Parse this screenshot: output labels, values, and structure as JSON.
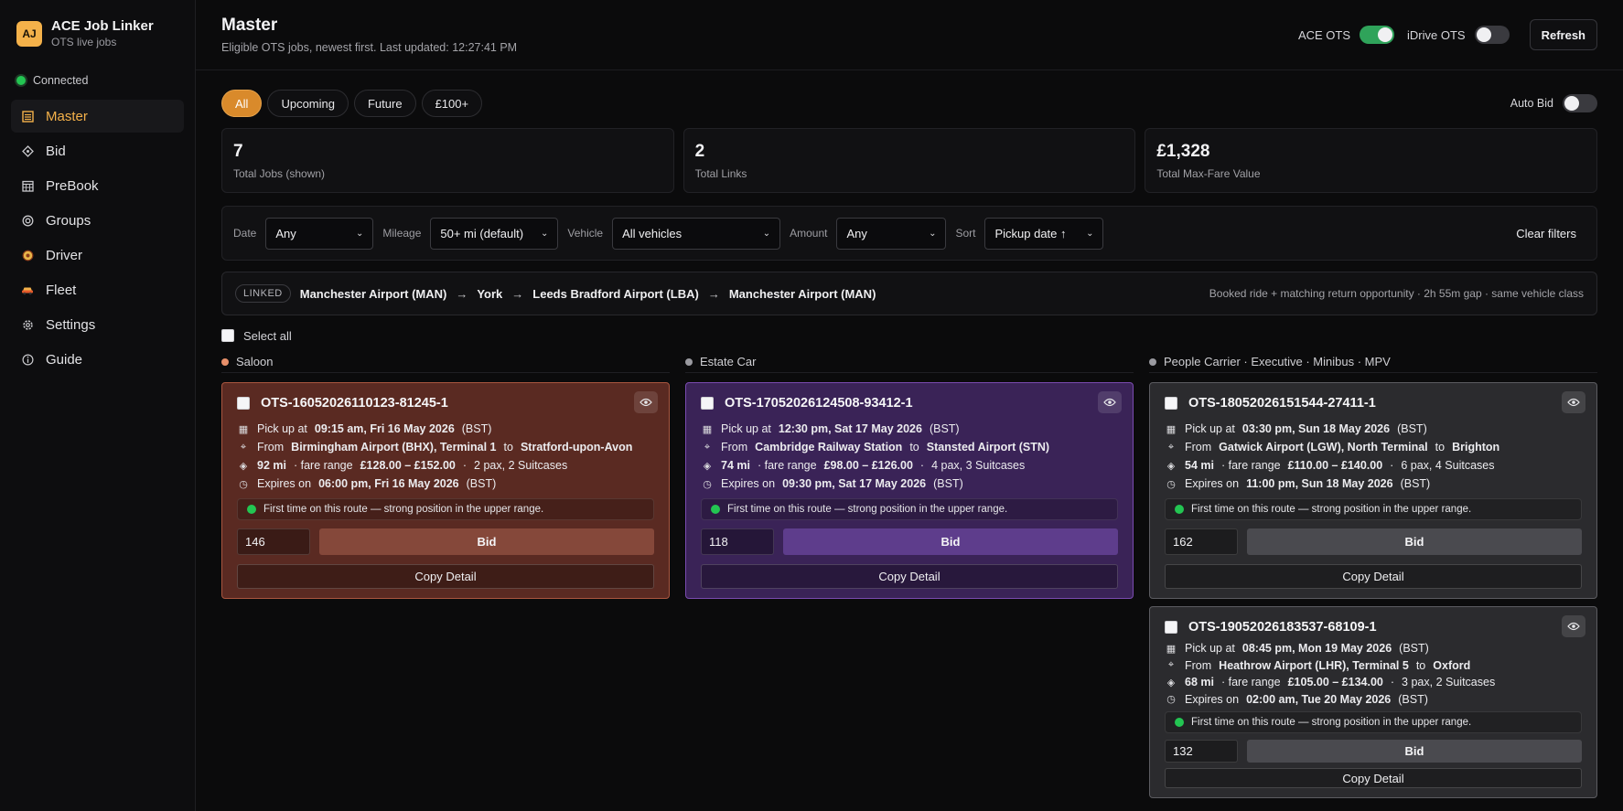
{
  "brand": {
    "logo": "AJ",
    "title": "ACE Job Linker",
    "subtitle": "OTS live jobs"
  },
  "connection": {
    "label": "Connected",
    "color": "#23c552"
  },
  "nav": [
    {
      "id": "master",
      "label": "Master",
      "icon": "list-icon",
      "active": true
    },
    {
      "id": "bid",
      "label": "Bid",
      "icon": "diamond-icon"
    },
    {
      "id": "prebook",
      "label": "PreBook",
      "icon": "calendar-icon"
    },
    {
      "id": "groups",
      "label": "Groups",
      "icon": "target-icon"
    },
    {
      "id": "driver",
      "label": "Driver",
      "icon": "driver-icon"
    },
    {
      "id": "fleet",
      "label": "Fleet",
      "icon": "car-icon"
    },
    {
      "id": "settings",
      "label": "Settings",
      "icon": "gear-icon"
    },
    {
      "id": "guide",
      "label": "Guide",
      "icon": "info-icon"
    }
  ],
  "header": {
    "title": "Master",
    "subtitle": "Eligible OTS jobs, newest first. Last updated: 12:27:41 PM",
    "ace_toggle_label": "ACE OTS",
    "idrive_toggle_label": "iDrive OTS",
    "refresh_label": "Refresh"
  },
  "chips": [
    "All",
    "Upcoming",
    "Future",
    "£100+"
  ],
  "autobid_label": "Auto Bid",
  "stats": [
    {
      "value": "7",
      "label": "Total Jobs (shown)"
    },
    {
      "value": "2",
      "label": "Total Links"
    },
    {
      "value": "£1,328",
      "label": "Total Max-Fare Value"
    }
  ],
  "filters": {
    "date_label": "Date",
    "date_value": "Any",
    "mileage_label": "Mileage",
    "mileage_value": "50+ mi (default)",
    "vehicle_label": "Vehicle",
    "vehicle_value": "All vehicles",
    "amount_label": "Amount",
    "amount_value": "Any",
    "sort_label": "Sort",
    "sort_value": "Pickup date ↑",
    "clear_label": "Clear filters"
  },
  "linked": {
    "badge": "LINKED",
    "stops": [
      "Manchester Airport (MAN)",
      "York",
      "Leeds Bradford Airport (LBA)",
      "Manchester Airport (MAN)"
    ],
    "note": "Booked ride + matching return opportunity · 2h 55m gap · same vehicle class"
  },
  "select_all_label": "Select all",
  "columns": [
    {
      "name": "Saloon",
      "dot": "#e8906a"
    },
    {
      "name": "Estate Car",
      "dot": "#9a9aa0"
    },
    {
      "name": "People Carrier · Executive · Minibus · MPV",
      "dot": "#9a9aa0"
    }
  ],
  "hint_text": "First time on this route — strong position in the upper range.",
  "bid_label": "Bid",
  "copy_label": "Copy Detail",
  "jobs": [
    {
      "id": "OTS-16052026110123-81245-1",
      "pickup_time": "09:15 am, Fri 16 May 2026",
      "from": "Birmingham Airport (BHX), Terminal 1",
      "to": "Stratford-upon-Avon",
      "miles": "92 mi",
      "fare": "£128.00 – £152.00",
      "pax": "2 pax, 2 Suitcases",
      "expires": "06:00 pm, Fri 16 May 2026",
      "bid": "146"
    },
    {
      "id": "OTS-17052026124508-93412-1",
      "pickup_time": "12:30 pm, Sat 17 May 2026",
      "from": "Cambridge Railway Station",
      "to": "Stansted Airport (STN)",
      "miles": "74 mi",
      "fare": "£98.00 – £126.00",
      "pax": "4 pax, 3 Suitcases",
      "expires": "09:30 pm, Sat 17 May 2026",
      "bid": "118"
    },
    {
      "id": "OTS-18052026151544-27411-1",
      "pickup_time": "03:30 pm, Sun 18 May 2026",
      "from": "Gatwick Airport (LGW), North Terminal",
      "to": "Brighton",
      "miles": "54 mi",
      "fare": "£110.00 – £140.00",
      "pax": "6 pax, 4 Suitcases",
      "expires": "11:00 pm, Sun 18 May 2026",
      "bid": "162"
    },
    {
      "id": "OTS-19052026183537-68109-1",
      "pickup_time": "08:45 pm, Mon 19 May 2026",
      "from": "Heathrow Airport (LHR), Terminal 5",
      "to": "Oxford",
      "miles": "68 mi",
      "fare": "£105.00 – £134.00",
      "pax": "3 pax, 2 Suitcases",
      "expires": "02:00 am, Tue 20 May 2026",
      "bid": "132"
    }
  ],
  "text": {
    "pickup_prefix": "Pick up at",
    "bst": "(BST)",
    "from_prefix": "From",
    "to_word": "to",
    "fare_prefix": "· fare range",
    "sep": "·",
    "expires_prefix": "Expires on"
  }
}
